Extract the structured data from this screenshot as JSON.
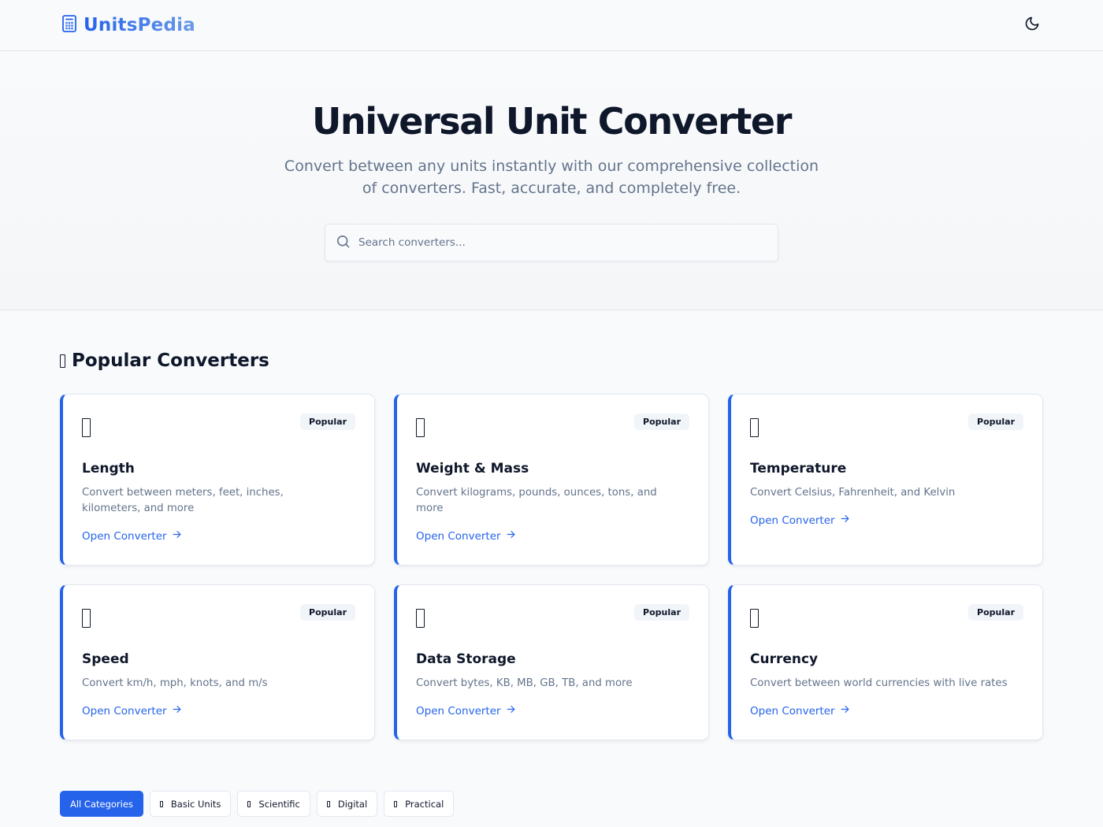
{
  "header": {
    "logo_text": "UnitsPedia",
    "logo_icon": "calculator-icon",
    "theme_toggle_icon": "moon-icon"
  },
  "hero": {
    "title": "Universal Unit Converter",
    "subtitle": "Convert between any units instantly with our comprehensive collection of converters. Fast, accurate, and completely free.",
    "search_placeholder": "Search converters...",
    "search_value": ""
  },
  "popular": {
    "title": "Popular Converters",
    "title_icon": "missing-glyph-icon",
    "cards": [
      {
        "title": "Length",
        "description": "Convert between meters, feet, inches, kilometers, and more",
        "badge": "Popular",
        "link": "Open Converter",
        "icon": "missing-glyph-icon"
      },
      {
        "title": "Weight & Mass",
        "description": "Convert kilograms, pounds, ounces, tons, and more",
        "badge": "Popular",
        "link": "Open Converter",
        "icon": "missing-glyph-icon"
      },
      {
        "title": "Temperature",
        "description": "Convert Celsius, Fahrenheit, and Kelvin",
        "badge": "Popular",
        "link": "Open Converter",
        "icon": "missing-glyph-icon"
      },
      {
        "title": "Speed",
        "description": "Convert km/h, mph, knots, and m/s",
        "badge": "Popular",
        "link": "Open Converter",
        "icon": "missing-glyph-icon"
      },
      {
        "title": "Data Storage",
        "description": "Convert bytes, KB, MB, GB, TB, and more",
        "badge": "Popular",
        "link": "Open Converter",
        "icon": "missing-glyph-icon"
      },
      {
        "title": "Currency",
        "description": "Convert between world currencies with live rates",
        "badge": "Popular",
        "link": "Open Converter",
        "icon": "missing-glyph-icon"
      }
    ]
  },
  "filters": [
    {
      "label": "All Categories",
      "active": true
    },
    {
      "label": "Basic Units",
      "active": false
    },
    {
      "label": "Scientific",
      "active": false
    },
    {
      "label": "Digital",
      "active": false
    },
    {
      "label": "Practical",
      "active": false
    }
  ],
  "colors": {
    "accent": "#2563eb",
    "text": "#0f172a",
    "muted": "#64748b",
    "border": "#e2e8f0",
    "background": "#f8fafc"
  }
}
